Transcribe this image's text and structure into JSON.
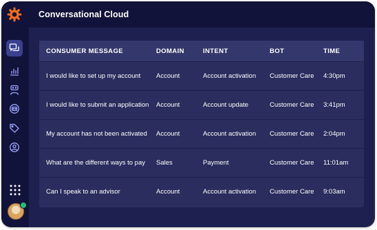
{
  "app": {
    "title": "Conversational Cloud",
    "logo_icon": "orange-gear-logo",
    "colors": {
      "accent": "#f26b1d",
      "background": "#1e2050",
      "topbar": "#12133a",
      "table": "#2a2d5e",
      "online": "#19c37d"
    }
  },
  "sidebar": {
    "items": [
      {
        "name": "conversations",
        "icon": "chat-bubbles-icon",
        "active": true
      },
      {
        "name": "analytics",
        "icon": "bar-chart-icon",
        "active": false
      },
      {
        "name": "agents",
        "icon": "agent-icon",
        "active": false
      },
      {
        "name": "bots",
        "icon": "bot-icon",
        "active": false
      },
      {
        "name": "tags",
        "icon": "tag-icon",
        "active": false
      },
      {
        "name": "profile",
        "icon": "user-circle-icon",
        "active": false
      }
    ],
    "apps_icon": "grid-dots-icon",
    "avatar_status": "online"
  },
  "table": {
    "columns": [
      "CONSUMER MESSAGE",
      "DOMAIN",
      "INTENT",
      "BOT",
      "TIME"
    ],
    "rows": [
      [
        "I would like to set up my account",
        "Account",
        "Account activation",
        "Customer Care",
        "4:30pm"
      ],
      [
        "I would like to submit an application",
        "Account",
        "Account update",
        "Customer Care",
        "3:41pm"
      ],
      [
        "My account has not been activated",
        "Account",
        "Account activation",
        "Customer Care",
        "2:04pm"
      ],
      [
        "What are the different ways to pay",
        "Sales",
        "Payment",
        "Customer Care",
        "11:01am"
      ],
      [
        "Can I speak to an advisor",
        "Account",
        "Account activation",
        "Customer Care",
        "9:03am"
      ]
    ]
  }
}
